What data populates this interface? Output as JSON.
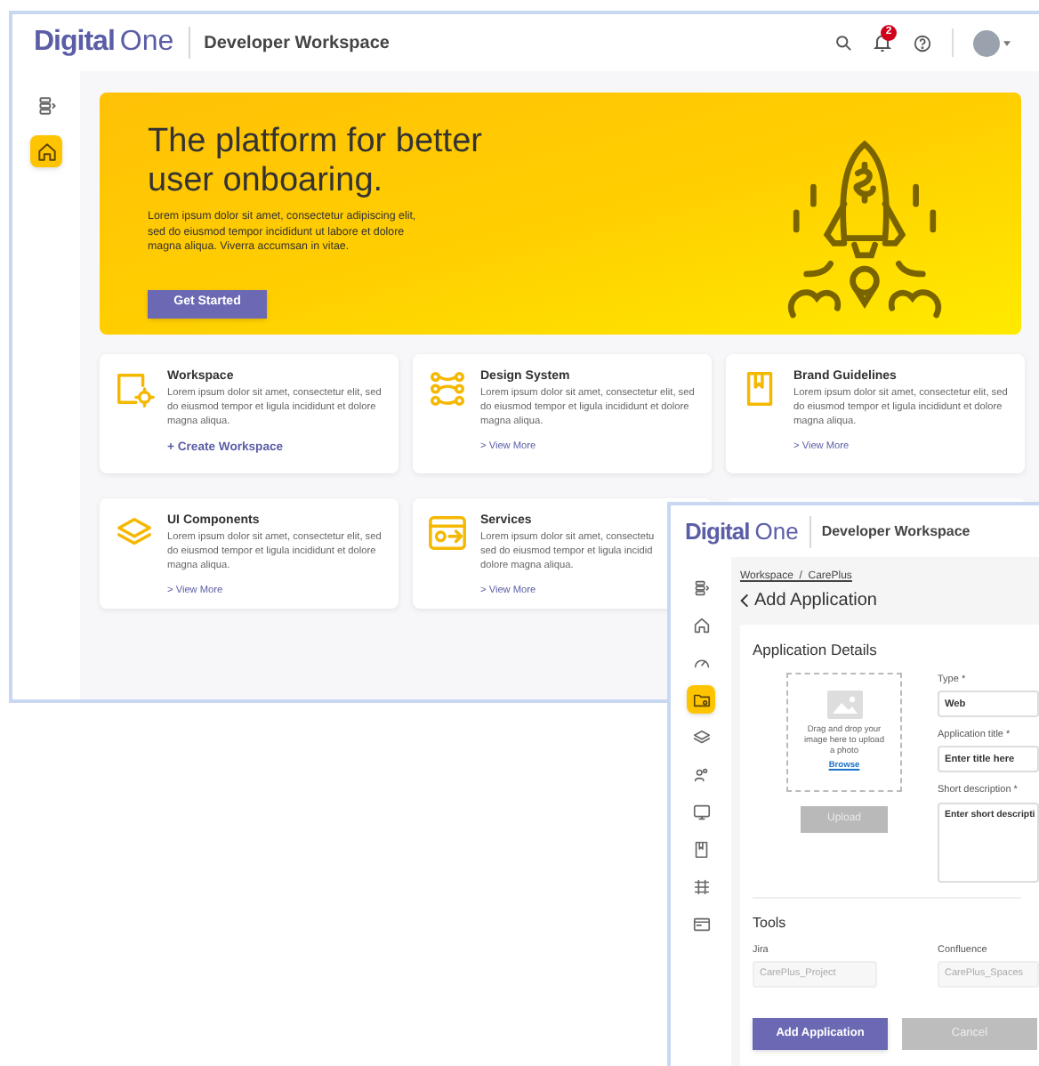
{
  "back_window": {
    "header": {
      "logo_bold": "Digital",
      "logo_light": "One",
      "title": "Developer Workspace",
      "notification_count": "2"
    },
    "sidebar": {
      "items": [
        {
          "kind": "toggle",
          "selected": false
        },
        {
          "kind": "home",
          "selected": true
        }
      ]
    },
    "hero": {
      "title": "The platform for better user onboaring.",
      "text": "Lorem ipsum dolor sit amet, consectetur adipiscing elit, sed do eiusmod tempor incididunt ut labore et dolore magna aliqua. Viverra accumsan in vitae.",
      "button": "Get Started"
    },
    "cards": [
      {
        "kind": "workspace",
        "title": "Workspace",
        "text": "Lorem ipsum dolor sit amet, consectetur elit, sed do eiusmod tempor et ligula incididunt et dolore magna aliqua.",
        "link": "+ Create Workspace",
        "primary": true
      },
      {
        "kind": "design",
        "title": "Design System",
        "text": "Lorem ipsum dolor sit amet, consectetur elit, sed do eiusmod tempor et ligula incididunt et dolore magna aliqua.",
        "link": "> View More",
        "primary": false
      },
      {
        "kind": "book",
        "title": "Brand Guidelines",
        "text": "Lorem ipsum dolor sit amet, consectetur elit, sed do eiusmod tempor et ligula incididunt et dolore magna aliqua.",
        "link": "> View More",
        "primary": false
      },
      {
        "kind": "layers",
        "title": "UI Components",
        "text": "Lorem ipsum dolor sit amet, consectetur elit, sed do eiusmod tempor et ligula incididunt et dolore magna aliqua.",
        "link": "> View More",
        "primary": false
      },
      {
        "kind": "services",
        "title": "Services",
        "text": "Lorem ipsum dolor sit amet, consectetu\nsed do eiusmod tempor et ligula incidid\ndolore magna aliqua.",
        "link": "> View More",
        "primary": false
      }
    ]
  },
  "front_window": {
    "header": {
      "logo_bold": "Digital",
      "logo_light": "One",
      "title": "Developer Workspace"
    },
    "sidebar": {
      "items": [
        {
          "kind": "toggle",
          "selected": false
        },
        {
          "kind": "home",
          "selected": false
        },
        {
          "kind": "gauge",
          "selected": false
        },
        {
          "kind": "folder",
          "selected": true
        },
        {
          "kind": "layers",
          "selected": false
        },
        {
          "kind": "people",
          "selected": false
        },
        {
          "kind": "monitor",
          "selected": false
        },
        {
          "kind": "book",
          "selected": false
        },
        {
          "kind": "grid",
          "selected": false
        },
        {
          "kind": "card",
          "selected": false
        }
      ]
    },
    "breadcrumb": "Workspace  /  CarePlus",
    "page_title": "Add Application",
    "details": {
      "title": "Application Details",
      "dropzone": {
        "text": "Drag and drop your image here to upload a photo",
        "link": "Browse"
      },
      "upload_button": {
        "label": "Upload",
        "disabled": true
      },
      "fields": [
        {
          "kind": "input",
          "label": "Type *",
          "value": "Web"
        },
        {
          "kind": "input",
          "label": "Application title *",
          "placeholder": "Enter title here"
        },
        {
          "kind": "textarea",
          "label": "Short description *",
          "placeholder": "Enter short descripti"
        }
      ]
    },
    "tools": {
      "title": "Tools",
      "fields": [
        {
          "label": "Jira",
          "value": "CarePlus_Project",
          "disabled": true
        },
        {
          "label": "Confluence",
          "value": "CarePlus_Spaces",
          "disabled": true
        }
      ]
    },
    "buttons": [
      {
        "label": "Add Application",
        "disabled": false
      },
      {
        "label": "Cancel",
        "disabled": true
      }
    ]
  }
}
